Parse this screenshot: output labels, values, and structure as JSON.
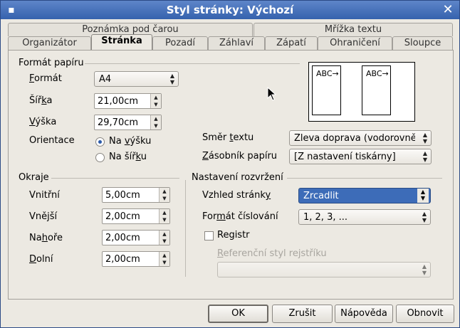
{
  "window": {
    "title": "Styl stránky: Výchozí"
  },
  "tabs_row1": [
    "Poznámka pod čarou",
    "Mřížka textu"
  ],
  "tabs_row2": [
    "Organizátor",
    "Stránka",
    "Pozadí",
    "Záhlaví",
    "Zápatí",
    "Ohraničení",
    "Sloupce"
  ],
  "paper": {
    "group": "Formát papíru",
    "format_label_u": "F",
    "format_label_rest": "ormát",
    "format_value": "A4",
    "width_label_a": "Šíř",
    "width_label_u": "k",
    "width_label_b": "a",
    "width_value": "21,00cm",
    "height_label_u": "V",
    "height_label_rest": "ýška",
    "height_value": "29,70cm",
    "orientation_label": "Orientace",
    "portrait_label_a": "Na ",
    "portrait_label_u": "v",
    "portrait_label_b": "ýšku",
    "landscape_label_a": "Na šíř",
    "landscape_label_u": "k",
    "landscape_label_b": "u",
    "text_dir_label_a": "Směr ",
    "text_dir_label_u": "t",
    "text_dir_label_b": "extu",
    "text_dir_value": "Zleva doprava (vodorovně)",
    "tray_label_u": "Z",
    "tray_label_rest": "ásobník papíru",
    "tray_value": "[Z nastavení tiskárny]",
    "preview_text": "ABC→"
  },
  "margins": {
    "group": "Okraje",
    "inner_label": "Vnitřní",
    "inner_value": "5,00cm",
    "outer_label": "Vnější",
    "outer_value": "2,00cm",
    "top_label_a": "Na",
    "top_label_u": "h",
    "top_label_b": "oře",
    "top_value": "2,00cm",
    "bottom_label_u": "D",
    "bottom_label_rest": "olní",
    "bottom_value": "2,00cm"
  },
  "layout": {
    "group": "Nastavení rozvržení",
    "page_layout_label_a": "Vzhled stránk",
    "page_layout_label_u": "y",
    "page_layout_value": "Zrcadlit",
    "numbering_label_a": "For",
    "numbering_label_u": "m",
    "numbering_label_b": "át číslování",
    "numbering_value": "1, 2, 3, ...",
    "register_label": "Registr",
    "ref_style_label_u": "R",
    "ref_style_label_rest": "eferenční styl rejstříku",
    "ref_style_value": ""
  },
  "buttons": {
    "ok": "OK",
    "cancel": "Zrušit",
    "help": "Nápověda",
    "reset": "Obnovit"
  },
  "colors": {
    "titlebar": "#3d6cb8",
    "selection": "#3d6cb8",
    "dialog_bg": "#ece9e2"
  }
}
